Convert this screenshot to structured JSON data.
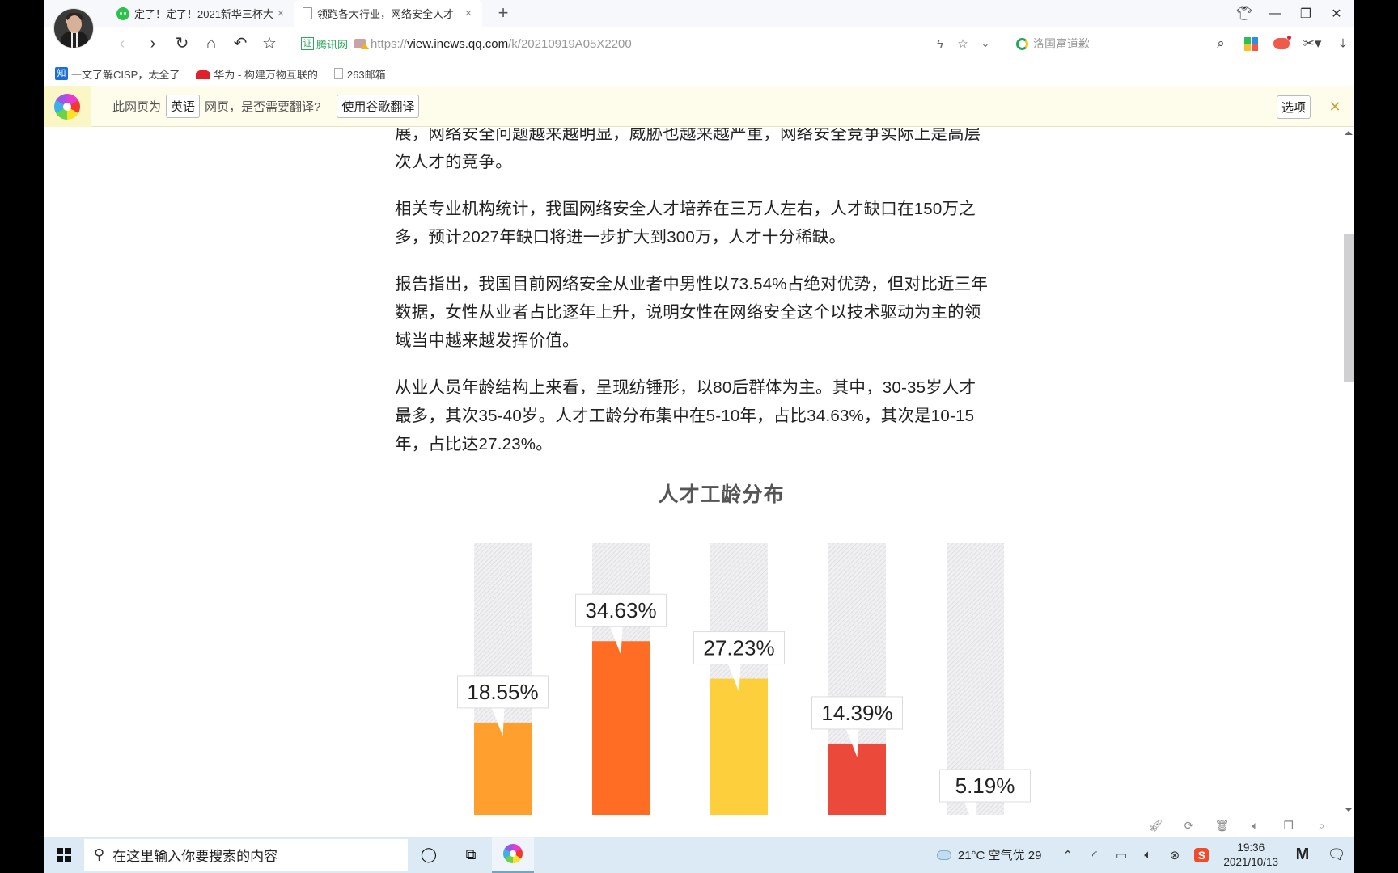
{
  "browser": {
    "tabs": [
      {
        "label": "定了！定了！2021新华三杯大",
        "icon": "wechat-icon",
        "active": false
      },
      {
        "label": "领跑各大行业，网络安全人才",
        "icon": "document-icon",
        "active": true
      }
    ],
    "new_tab_label": "+",
    "window_controls": {
      "skin": "T-shirt skin",
      "minimize": "—",
      "restore": "❐",
      "close": "✕"
    },
    "nav": {
      "back": "‹",
      "forward": "›",
      "reload": "↻",
      "home": "⌂",
      "undo": "↶",
      "favorite": "☆"
    },
    "address": {
      "cert_label": "证",
      "site_name": "腾讯网",
      "protocol": "https://",
      "host": "view.inews.qq.com",
      "path": "/k/20210919A05X2200"
    },
    "address_actions": {
      "speed": "ϟ",
      "favorite": "☆",
      "dropdown": "⌄"
    },
    "search": {
      "placeholder": "洛国富道歉"
    },
    "bookmarks": [
      {
        "label": "一文了解CISP，太全了",
        "icon": "zhihu-icon",
        "icon_text": "知"
      },
      {
        "label": "华为 - 构建万物互联的",
        "icon": "huawei-icon"
      },
      {
        "label": "263邮箱",
        "icon": "folder-icon"
      }
    ],
    "translate_bar": {
      "prefix": "此网页为",
      "language": "英语",
      "question": "网页，是否需要翻译?",
      "translate_button": "使用谷歌翻译",
      "options_button": "选项",
      "close": "✕"
    }
  },
  "article": {
    "paragraphs": [
      "展，网络安全问题越来越明显，威胁也越来越严重，网络安全竞争实际上是高层次人才的竞争。",
      "相关专业机构统计，我国网络安全人才培养在三万人左右，人才缺口在150万之多，预计2027年缺口将进一步扩大到300万，人才十分稀缺。",
      "报告指出，我国目前网络安全从业者中男性以73.54%占绝对优势，但对比近三年数据，女性从业者占比逐年上升，说明女性在网络安全这个以技术驱动为主的领域当中越来越发挥价值。",
      "从业人员年龄结构上来看，呈现纺锤形，以80后群体为主。其中，30-35岁人才最多，其次35-40岁。人才工龄分布集中在5-10年，占比34.63%，其次是10-15年，占比达27.23%。"
    ]
  },
  "chart_data": {
    "type": "bar",
    "title": "人才工龄分布",
    "categories": [
      "",
      "",
      "",
      "",
      ""
    ],
    "values": [
      18.55,
      34.63,
      27.23,
      14.39,
      5.19
    ],
    "labels": [
      "18.55%",
      "34.63%",
      "27.23%",
      "14.39%",
      "5.19%"
    ],
    "colors": [
      "#FF9F2E",
      "#FF6D24",
      "#FECF3D",
      "#EB4A3A",
      "#E4E4E6"
    ],
    "track_color": "#E9E9EB",
    "xlabel": "",
    "ylabel": "",
    "ylim": [
      0,
      54
    ],
    "grid": false,
    "legend": "none"
  },
  "statusbar": {
    "icons": [
      "rocket-icon",
      "refresh-plus-icon",
      "trash-icon",
      "speaker-icon",
      "window-icon",
      "search-icon"
    ]
  },
  "taskbar": {
    "search_placeholder": "在这里输入你要搜索的内容",
    "weather": "21°C 空气优 29",
    "time": "19:36",
    "date": "2021/10/13",
    "ime_label": "S",
    "app_label": "M"
  }
}
